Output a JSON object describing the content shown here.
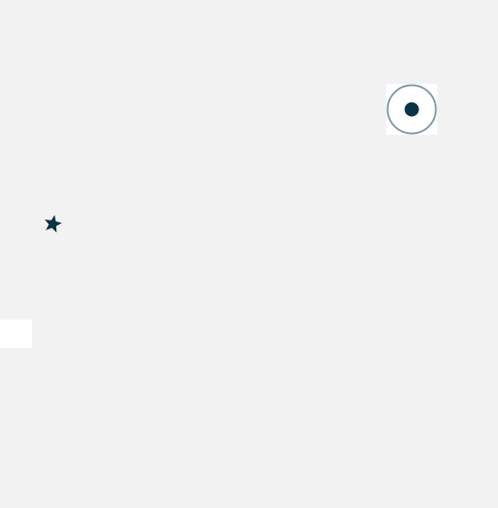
{
  "colors": {
    "background": "#f2f2f2",
    "panel": "#ffffff",
    "accent": "#0b3542",
    "ring": "#7f98a2"
  },
  "icons": {
    "target": "radio-target-icon",
    "star": "star-icon"
  }
}
